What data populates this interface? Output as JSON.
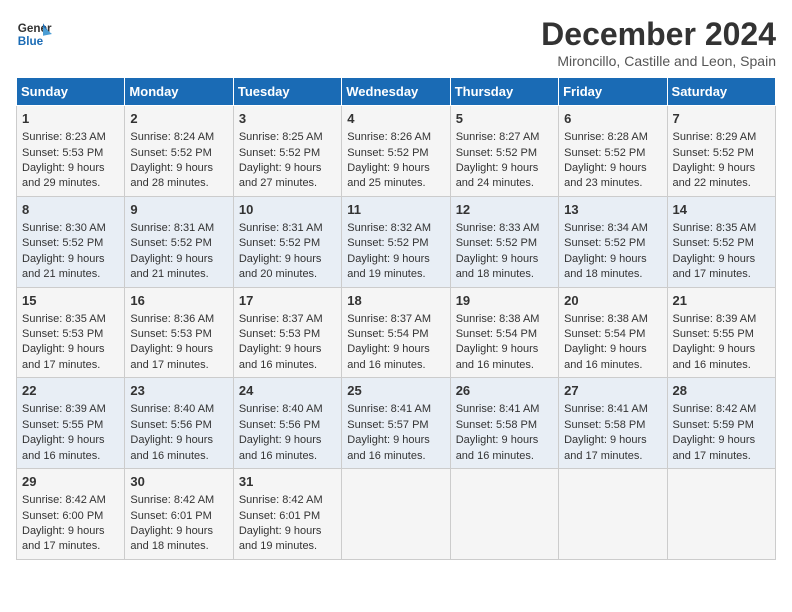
{
  "header": {
    "logo_line1": "General",
    "logo_line2": "Blue",
    "title": "December 2024",
    "subtitle": "Mironcillo, Castille and Leon, Spain"
  },
  "calendar": {
    "headers": [
      "Sunday",
      "Monday",
      "Tuesday",
      "Wednesday",
      "Thursday",
      "Friday",
      "Saturday"
    ],
    "weeks": [
      [
        {
          "day": "",
          "content": ""
        },
        {
          "day": "2",
          "content": "Sunrise: 8:24 AM\nSunset: 5:52 PM\nDaylight: 9 hours\nand 28 minutes."
        },
        {
          "day": "3",
          "content": "Sunrise: 8:25 AM\nSunset: 5:52 PM\nDaylight: 9 hours\nand 27 minutes."
        },
        {
          "day": "4",
          "content": "Sunrise: 8:26 AM\nSunset: 5:52 PM\nDaylight: 9 hours\nand 25 minutes."
        },
        {
          "day": "5",
          "content": "Sunrise: 8:27 AM\nSunset: 5:52 PM\nDaylight: 9 hours\nand 24 minutes."
        },
        {
          "day": "6",
          "content": "Sunrise: 8:28 AM\nSunset: 5:52 PM\nDaylight: 9 hours\nand 23 minutes."
        },
        {
          "day": "7",
          "content": "Sunrise: 8:29 AM\nSunset: 5:52 PM\nDaylight: 9 hours\nand 22 minutes."
        }
      ],
      [
        {
          "day": "8",
          "content": "Sunrise: 8:30 AM\nSunset: 5:52 PM\nDaylight: 9 hours\nand 21 minutes."
        },
        {
          "day": "9",
          "content": "Sunrise: 8:31 AM\nSunset: 5:52 PM\nDaylight: 9 hours\nand 21 minutes."
        },
        {
          "day": "10",
          "content": "Sunrise: 8:31 AM\nSunset: 5:52 PM\nDaylight: 9 hours\nand 20 minutes."
        },
        {
          "day": "11",
          "content": "Sunrise: 8:32 AM\nSunset: 5:52 PM\nDaylight: 9 hours\nand 19 minutes."
        },
        {
          "day": "12",
          "content": "Sunrise: 8:33 AM\nSunset: 5:52 PM\nDaylight: 9 hours\nand 18 minutes."
        },
        {
          "day": "13",
          "content": "Sunrise: 8:34 AM\nSunset: 5:52 PM\nDaylight: 9 hours\nand 18 minutes."
        },
        {
          "day": "14",
          "content": "Sunrise: 8:35 AM\nSunset: 5:52 PM\nDaylight: 9 hours\nand 17 minutes."
        }
      ],
      [
        {
          "day": "15",
          "content": "Sunrise: 8:35 AM\nSunset: 5:53 PM\nDaylight: 9 hours\nand 17 minutes."
        },
        {
          "day": "16",
          "content": "Sunrise: 8:36 AM\nSunset: 5:53 PM\nDaylight: 9 hours\nand 17 minutes."
        },
        {
          "day": "17",
          "content": "Sunrise: 8:37 AM\nSunset: 5:53 PM\nDaylight: 9 hours\nand 16 minutes."
        },
        {
          "day": "18",
          "content": "Sunrise: 8:37 AM\nSunset: 5:54 PM\nDaylight: 9 hours\nand 16 minutes."
        },
        {
          "day": "19",
          "content": "Sunrise: 8:38 AM\nSunset: 5:54 PM\nDaylight: 9 hours\nand 16 minutes."
        },
        {
          "day": "20",
          "content": "Sunrise: 8:38 AM\nSunset: 5:54 PM\nDaylight: 9 hours\nand 16 minutes."
        },
        {
          "day": "21",
          "content": "Sunrise: 8:39 AM\nSunset: 5:55 PM\nDaylight: 9 hours\nand 16 minutes."
        }
      ],
      [
        {
          "day": "22",
          "content": "Sunrise: 8:39 AM\nSunset: 5:55 PM\nDaylight: 9 hours\nand 16 minutes."
        },
        {
          "day": "23",
          "content": "Sunrise: 8:40 AM\nSunset: 5:56 PM\nDaylight: 9 hours\nand 16 minutes."
        },
        {
          "day": "24",
          "content": "Sunrise: 8:40 AM\nSunset: 5:56 PM\nDaylight: 9 hours\nand 16 minutes."
        },
        {
          "day": "25",
          "content": "Sunrise: 8:41 AM\nSunset: 5:57 PM\nDaylight: 9 hours\nand 16 minutes."
        },
        {
          "day": "26",
          "content": "Sunrise: 8:41 AM\nSunset: 5:58 PM\nDaylight: 9 hours\nand 16 minutes."
        },
        {
          "day": "27",
          "content": "Sunrise: 8:41 AM\nSunset: 5:58 PM\nDaylight: 9 hours\nand 17 minutes."
        },
        {
          "day": "28",
          "content": "Sunrise: 8:42 AM\nSunset: 5:59 PM\nDaylight: 9 hours\nand 17 minutes."
        }
      ],
      [
        {
          "day": "29",
          "content": "Sunrise: 8:42 AM\nSunset: 6:00 PM\nDaylight: 9 hours\nand 17 minutes."
        },
        {
          "day": "30",
          "content": "Sunrise: 8:42 AM\nSunset: 6:01 PM\nDaylight: 9 hours\nand 18 minutes."
        },
        {
          "day": "31",
          "content": "Sunrise: 8:42 AM\nSunset: 6:01 PM\nDaylight: 9 hours\nand 19 minutes."
        },
        {
          "day": "",
          "content": ""
        },
        {
          "day": "",
          "content": ""
        },
        {
          "day": "",
          "content": ""
        },
        {
          "day": "",
          "content": ""
        }
      ]
    ],
    "first_week_first_day": {
      "day": "1",
      "content": "Sunrise: 8:23 AM\nSunset: 5:53 PM\nDaylight: 9 hours\nand 29 minutes."
    }
  }
}
